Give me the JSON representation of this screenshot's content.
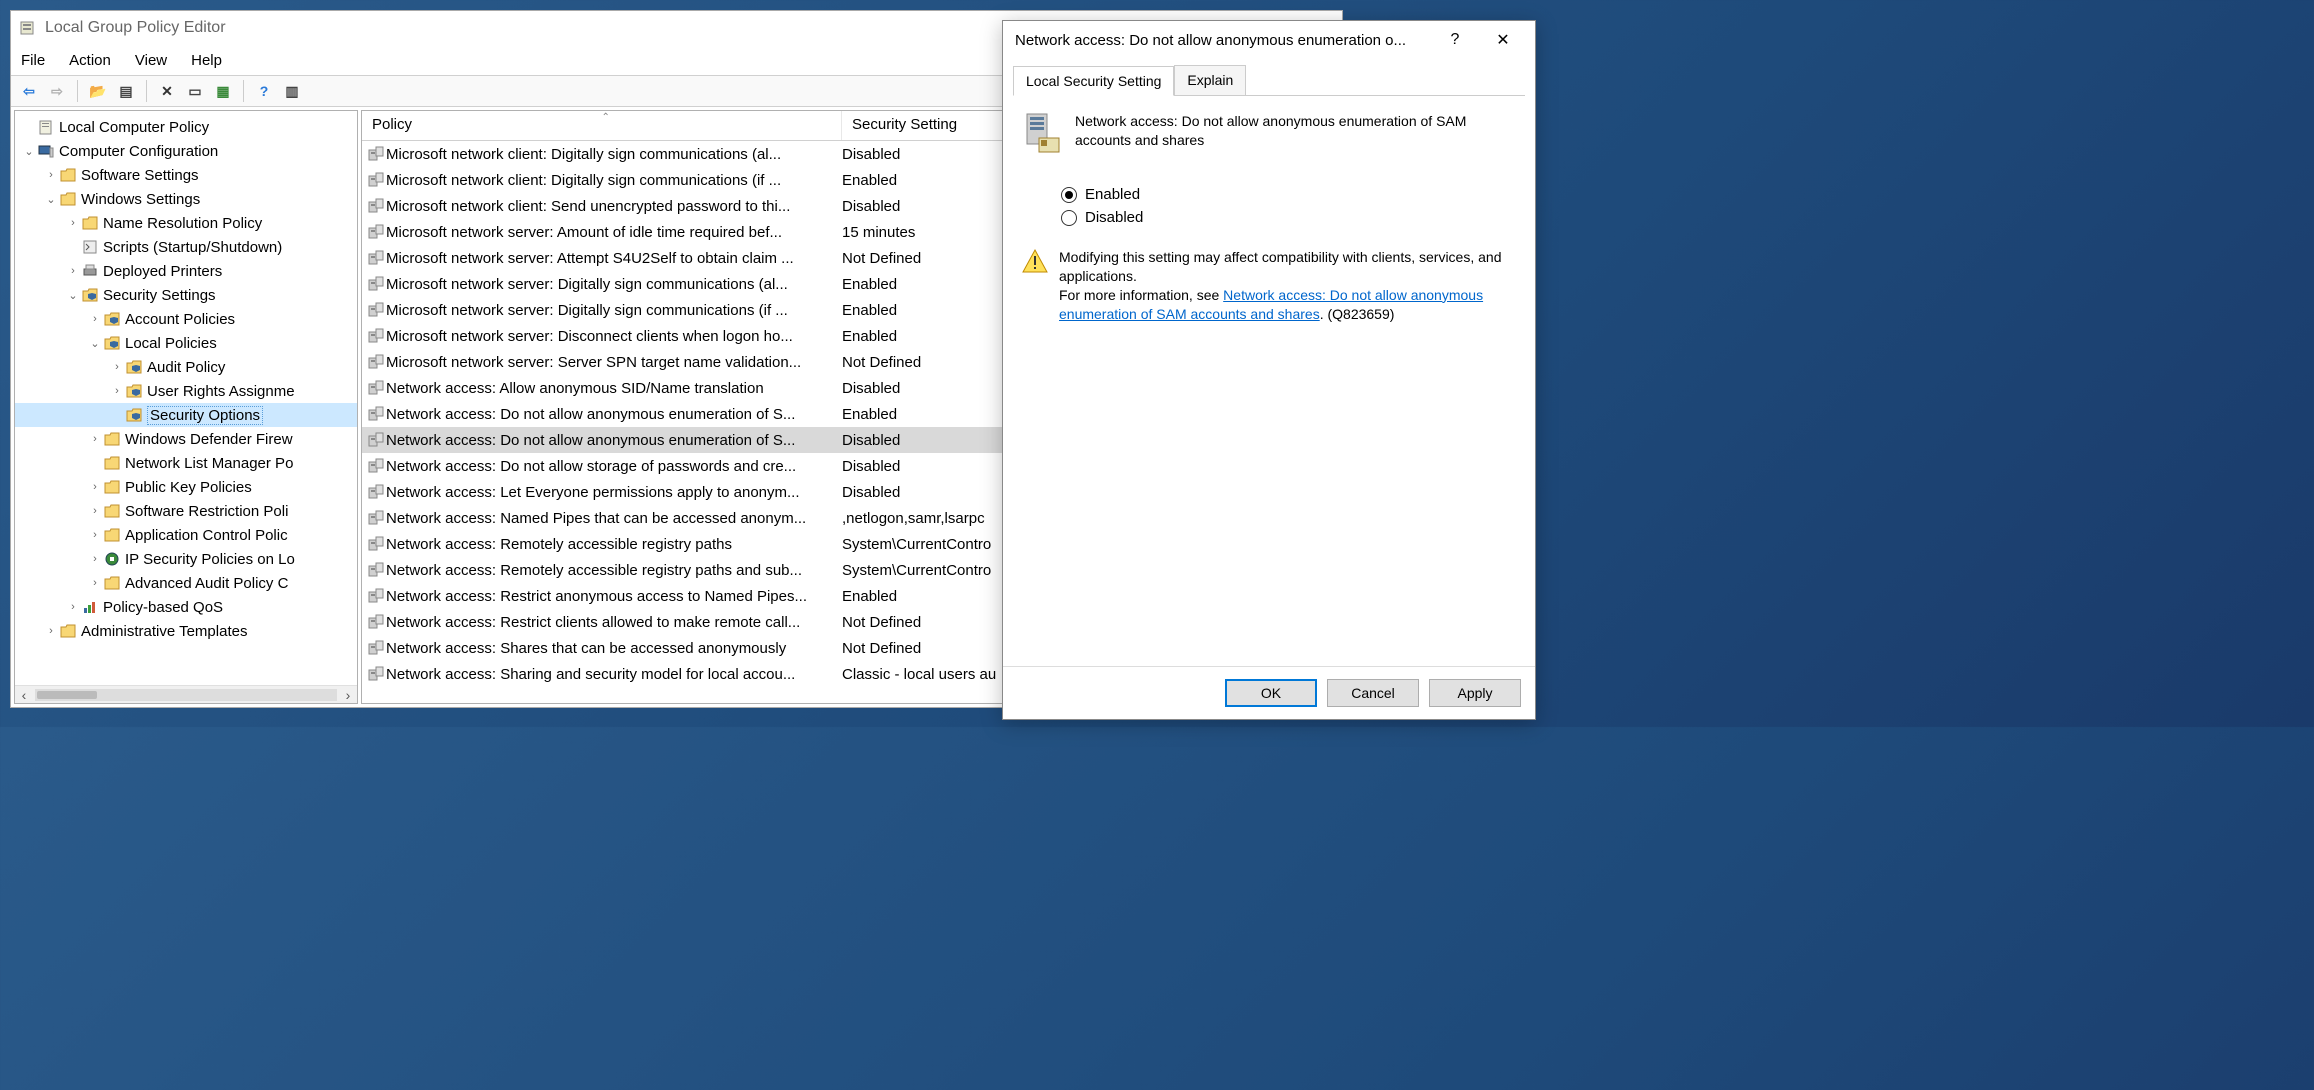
{
  "main_window": {
    "title": "Local Group Policy Editor",
    "menubar": [
      "File",
      "Action",
      "View",
      "Help"
    ],
    "toolbar": [
      {
        "name": "back-icon",
        "glyph": "⇦",
        "color": "#2a7ad9"
      },
      {
        "name": "forward-icon",
        "glyph": "⇨",
        "color": "#b0b0b0"
      },
      {
        "sep": true
      },
      {
        "name": "up-folder-icon",
        "glyph": "📂",
        "color": "#444"
      },
      {
        "name": "show-hide-tree-icon",
        "glyph": "▤",
        "color": "#444"
      },
      {
        "sep": true
      },
      {
        "name": "delete-icon",
        "glyph": "✕",
        "color": "#333"
      },
      {
        "name": "properties-icon",
        "glyph": "▭",
        "color": "#444"
      },
      {
        "name": "export-list-icon",
        "glyph": "▦",
        "color": "#3a8a3a"
      },
      {
        "sep": true
      },
      {
        "name": "help-icon",
        "glyph": "?",
        "color": "#2a7ad9"
      },
      {
        "name": "show-hide-action-pane-icon",
        "glyph": "▥",
        "color": "#444"
      }
    ],
    "tree": [
      {
        "depth": 0,
        "exp": "",
        "icon": "doc",
        "label": "Local Computer Policy"
      },
      {
        "depth": 0,
        "exp": "v",
        "icon": "computer",
        "label": "Computer Configuration"
      },
      {
        "depth": 1,
        "exp": ">",
        "icon": "folder",
        "label": "Software Settings"
      },
      {
        "depth": 1,
        "exp": "v",
        "icon": "folder",
        "label": "Windows Settings"
      },
      {
        "depth": 2,
        "exp": ">",
        "icon": "folder",
        "label": "Name Resolution Policy"
      },
      {
        "depth": 2,
        "exp": "",
        "icon": "script",
        "label": "Scripts (Startup/Shutdown)"
      },
      {
        "depth": 2,
        "exp": ">",
        "icon": "printer",
        "label": "Deployed Printers"
      },
      {
        "depth": 2,
        "exp": "v",
        "icon": "shield-folder",
        "label": "Security Settings"
      },
      {
        "depth": 3,
        "exp": ">",
        "icon": "shield-folder",
        "label": "Account Policies"
      },
      {
        "depth": 3,
        "exp": "v",
        "icon": "shield-folder",
        "label": "Local Policies"
      },
      {
        "depth": 4,
        "exp": ">",
        "icon": "shield-folder",
        "label": "Audit Policy"
      },
      {
        "depth": 4,
        "exp": ">",
        "icon": "shield-folder",
        "label": "User Rights Assignme"
      },
      {
        "depth": 4,
        "exp": "",
        "icon": "shield-folder",
        "label": "Security Options",
        "selected": true
      },
      {
        "depth": 3,
        "exp": ">",
        "icon": "folder",
        "label": "Windows Defender Firew"
      },
      {
        "depth": 3,
        "exp": "",
        "icon": "folder",
        "label": "Network List Manager Po"
      },
      {
        "depth": 3,
        "exp": ">",
        "icon": "folder",
        "label": "Public Key Policies"
      },
      {
        "depth": 3,
        "exp": ">",
        "icon": "folder",
        "label": "Software Restriction Poli"
      },
      {
        "depth": 3,
        "exp": ">",
        "icon": "folder",
        "label": "Application Control Polic"
      },
      {
        "depth": 3,
        "exp": ">",
        "icon": "ipsec",
        "label": "IP Security Policies on Lo"
      },
      {
        "depth": 3,
        "exp": ">",
        "icon": "folder",
        "label": "Advanced Audit Policy C"
      },
      {
        "depth": 2,
        "exp": ">",
        "icon": "qos",
        "label": "Policy-based QoS"
      },
      {
        "depth": 1,
        "exp": ">",
        "icon": "folder",
        "label": "Administrative Templates"
      }
    ],
    "list": {
      "columns": {
        "policy": "Policy",
        "setting": "Security Setting"
      },
      "rows": [
        {
          "policy": "Microsoft network client: Digitally sign communications (al...",
          "setting": "Disabled"
        },
        {
          "policy": "Microsoft network client: Digitally sign communications (if ...",
          "setting": "Enabled"
        },
        {
          "policy": "Microsoft network client: Send unencrypted password to thi...",
          "setting": "Disabled"
        },
        {
          "policy": "Microsoft network server: Amount of idle time required bef...",
          "setting": "15 minutes"
        },
        {
          "policy": "Microsoft network server: Attempt S4U2Self to obtain claim ...",
          "setting": "Not Defined"
        },
        {
          "policy": "Microsoft network server: Digitally sign communications (al...",
          "setting": "Enabled"
        },
        {
          "policy": "Microsoft network server: Digitally sign communications (if ...",
          "setting": "Enabled"
        },
        {
          "policy": "Microsoft network server: Disconnect clients when logon ho...",
          "setting": "Enabled"
        },
        {
          "policy": "Microsoft network server: Server SPN target name validation...",
          "setting": "Not Defined"
        },
        {
          "policy": "Network access: Allow anonymous SID/Name translation",
          "setting": "Disabled"
        },
        {
          "policy": "Network access: Do not allow anonymous enumeration of S...",
          "setting": "Enabled"
        },
        {
          "policy": "Network access: Do not allow anonymous enumeration of S...",
          "setting": "Disabled",
          "selected": true
        },
        {
          "policy": "Network access: Do not allow storage of passwords and cre...",
          "setting": "Disabled"
        },
        {
          "policy": "Network access: Let Everyone permissions apply to anonym...",
          "setting": "Disabled"
        },
        {
          "policy": "Network access: Named Pipes that can be accessed anonym...",
          "setting": ",netlogon,samr,lsarpc"
        },
        {
          "policy": "Network access: Remotely accessible registry paths",
          "setting": "System\\CurrentContro"
        },
        {
          "policy": "Network access: Remotely accessible registry paths and sub...",
          "setting": "System\\CurrentContro"
        },
        {
          "policy": "Network access: Restrict anonymous access to Named Pipes...",
          "setting": "Enabled"
        },
        {
          "policy": "Network access: Restrict clients allowed to make remote call...",
          "setting": "Not Defined"
        },
        {
          "policy": "Network access: Shares that can be accessed anonymously",
          "setting": "Not Defined"
        },
        {
          "policy": "Network access: Sharing and security model for local accou...",
          "setting": "Classic - local users au"
        }
      ]
    }
  },
  "dialog": {
    "title": "Network access: Do not allow anonymous enumeration o...",
    "tabs": [
      "Local Security Setting",
      "Explain"
    ],
    "heading": "Network access: Do not allow anonymous enumeration of SAM accounts and shares",
    "radios": {
      "enabled": "Enabled",
      "disabled": "Disabled",
      "checked": "enabled"
    },
    "warning": {
      "line1": "Modifying this setting may affect compatibility with clients, services, and applications.",
      "line2_prefix": "For more information, see ",
      "link": "Network access: Do not allow anonymous enumeration of SAM accounts and shares",
      "link_suffix": ". (Q823659)"
    },
    "buttons": {
      "ok": "OK",
      "cancel": "Cancel",
      "apply": "Apply"
    }
  }
}
